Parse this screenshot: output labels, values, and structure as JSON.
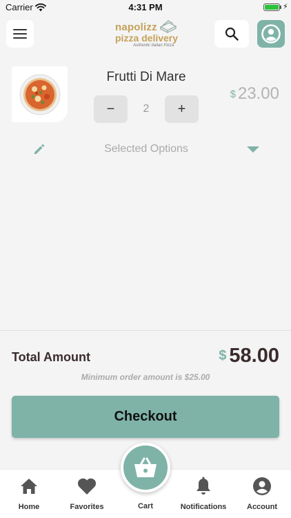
{
  "status_bar": {
    "carrier": "Carrier",
    "time": "4:31 PM",
    "bolt": "⚡"
  },
  "header": {
    "logo_line1": "napolizz",
    "logo_line2": "pizza delivery",
    "logo_tagline": "Authentic Italian Pizza",
    "icons": {
      "menu": "menu-icon",
      "search": "search-icon",
      "account": "account-icon"
    }
  },
  "cart_item": {
    "name": "Frutti Di Mare",
    "quantity": "2",
    "minus_label": "−",
    "plus_label": "+",
    "currency": "$",
    "price": "23.00",
    "options_label": "Selected Options"
  },
  "summary": {
    "total_label": "Total Amount",
    "currency": "$",
    "total_value": "58.00",
    "min_order_note": "Minimum order amount is $25.00",
    "checkout_label": "Checkout"
  },
  "tabbar": {
    "items": [
      {
        "label": "Home",
        "icon": "home-icon"
      },
      {
        "label": "Favorites",
        "icon": "heart-icon"
      },
      {
        "label": "Cart",
        "icon": "basket-icon"
      },
      {
        "label": "Notifications",
        "icon": "bell-icon"
      },
      {
        "label": "Account",
        "icon": "account-icon"
      }
    ]
  },
  "colors": {
    "accent": "#7fb3a8",
    "logo_gold": "#c5a15a",
    "background": "#f4f4f4",
    "dark_text": "#3a2c2c"
  }
}
